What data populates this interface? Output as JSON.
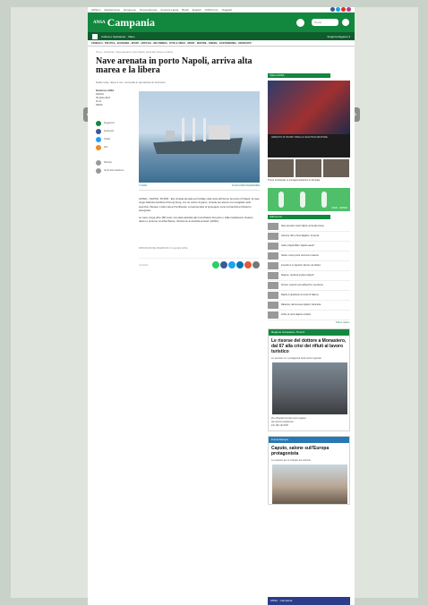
{
  "topbar": {
    "links": [
      "ANSA.it",
      "Mediterraneo",
      "Europa.eu",
      "Nuova Europa",
      "America Latina",
      "Brasil",
      "English",
      "ANSA Foto",
      "Viaggiart"
    ],
    "colors": {
      "facebook": "#3b5998",
      "twitter": "#1da1f2",
      "youtube": "#e52d27",
      "instagram": "#c13584"
    }
  },
  "header": {
    "logo": "ANSA",
    "region": "Campania",
    "search_placeholder": "Cerca",
    "accent": "#12873e"
  },
  "subnav": {
    "section": "Cultura e Spettacolo · Video",
    "right": "Scegli la Regione ▾"
  },
  "categories": "CRONACA · POLITICA · ECONOMIA · SPORT · ARTICOLI · MULTIMEDIA · FOTO & VIDEO · SPORT · MOSTRE · CINEMA · GASTRONOMIA · OROSCOPO",
  "article": {
    "breadcrumb": "Home › Campania › Nave arenata in porto Napoli, arriva alta marea e la libera",
    "title": "Nave arenata in porto Napoli, arriva alta marea e la libera",
    "subtitle": "Nella notte, dopo 2 ore, coinvolta in operazioni di soccorso",
    "meta": [
      "Redazione ANSA",
      "NAPOLI",
      "05 aprile 2023",
      "18:11",
      "NEWS"
    ],
    "share": [
      "Suggerisci",
      "Facebook",
      "Twitter",
      "Altri",
      "Stampa",
      "Scrivi alla redazione"
    ],
    "caption_left": "© ANSA",
    "caption_right": "CLICCA PER INGRANDIRE",
    "paragraphs": [
      "(ANSA) - NAPOLI, 05 APR - Era rimasta arenata sul fondale nella notte all'interno del porto di Napoli, la nave cargo battente bandiera di Hong Kong, con un carico di grano, rimasta per alcune ore incagliata nello specchio d'acqua. L'alta marea l'ha liberata, consentendole di proseguire verso la banchina d'attracco assegnata.",
      "La nave, lunga oltre 180 metri, era stata assistita dai rimorchiatori del porto e dalla Capitaneria. Nessun danno a persone né all'ambiente, riferiscono le autorità portuali. (ANSA)."
    ],
    "repro": "RIPRODUZIONE RISERVATA © Copyright ANSA",
    "bottom_share_label": "Condividi"
  },
  "rcol": {
    "video_head": "Video ANSA",
    "video_text": "ARRESTO DI TRUMP: PARLA IL NEO PROCURATORE",
    "thumb_caption": "Trump incriminato, le immagini dell'arrivo in tribunale",
    "ad_label": "SAVE · WATER",
    "latest_head": "Ultima ora",
    "latest": [
      "Nave arenata in porto Napoli, arriva alta marea",
      "Camorra, blitz a Secondigliano: 12 arresti",
      "Calcio, Napoli-Milan: biglietti esauriti",
      "Sanità, nuovo pronto soccorso a Caserta",
      "Incendio in un deposito, fiamme nel Nolano",
      "Regione, via libera al piano trasporti",
      "Pompei, scoperti nuovi affreschi in una domus",
      "Rapina in gioielleria nel centro di Salerno",
      "Maltempo, allerta meteo gialla in Campania",
      "Ischia, al via la stagione turistica"
    ],
    "latest_more": "Tutte le notizie ›",
    "promo_head": "Regione Campania, 70 anni",
    "promo_title": "Le risorse del dottore a Monastero, dal 67 alla crisi dei rifiuti al lavoro turistico",
    "promo_lead": "Lo speciale con i protagonisti della storia regionale",
    "promo_notes": [
      "25 e 26 aprile l'incontro con la regione",
      "Gli eventi in programma",
      "Info: 081 123 4567"
    ],
    "promo2_head": "Focus Europa",
    "promo2_title": "Caputo, salone sull'Europa protagonista",
    "promo2_lead": "Le proposte per lo sviluppo del territorio",
    "footer": "ANSA · Campania"
  }
}
